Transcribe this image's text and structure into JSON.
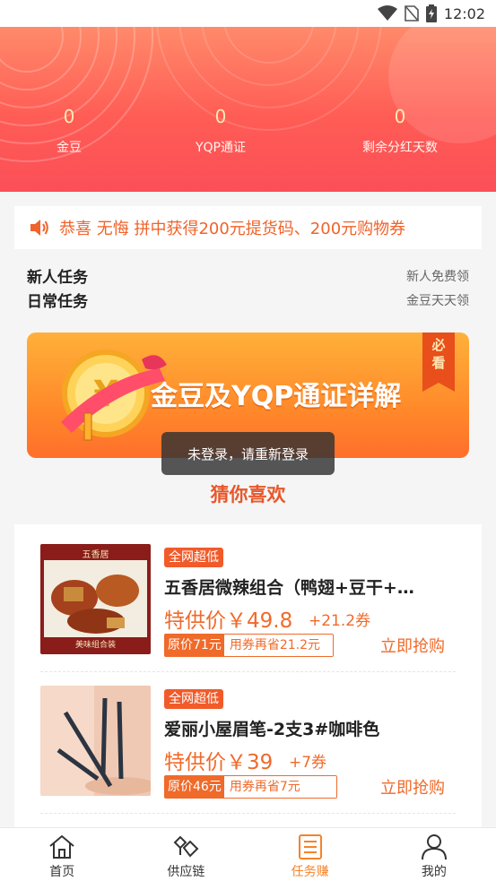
{
  "status_bar": {
    "time": "12:02"
  },
  "stats": [
    {
      "value": "0",
      "label": "金豆"
    },
    {
      "value": "0",
      "label": "YQP通证"
    },
    {
      "value": "0",
      "label": "剩余分红天数"
    }
  ],
  "notice": {
    "text": "恭喜 无悔 拼中获得200元提货码、200元购物券"
  },
  "tasks": [
    {
      "title": "新人任务",
      "subtitle": "新人免费领"
    },
    {
      "title": "日常任务",
      "subtitle": "金豆天天领"
    }
  ],
  "banner": {
    "title": "金豆及YQP通证详解",
    "badge_line1": "必",
    "badge_line2": "看"
  },
  "toast": "未登录，请重新登录",
  "section_title": "猜你喜欢",
  "products": [
    {
      "tag": "全网超低",
      "name": "五香居微辣组合（鸭翅+豆干+…",
      "price": "特供价￥49.8",
      "coupon": "+21.2券",
      "original": "原价71元",
      "saving": "用券再省21.2元",
      "buy": "立即抢购",
      "thumb_top_text": "五香居",
      "thumb_bottom_text": "美味组合装"
    },
    {
      "tag": "全网超低",
      "name": "爱丽小屋眉笔-2支3#咖啡色",
      "price": "特供价￥39",
      "coupon": "+7券",
      "original": "原价46元",
      "saving": "用券再省7元",
      "buy": "立即抢购"
    }
  ],
  "tabs": [
    {
      "label": "首页",
      "icon": "home-icon"
    },
    {
      "label": "供应链",
      "icon": "supply-chain-icon"
    },
    {
      "label": "任务赚",
      "icon": "task-list-icon",
      "active": true
    },
    {
      "label": "我的",
      "icon": "user-icon"
    }
  ],
  "colors": {
    "accent": "#f06a2a",
    "hero_top": "#ff8a6a",
    "hero_bottom": "#fb4f58",
    "tab_active": "#f5832a"
  }
}
